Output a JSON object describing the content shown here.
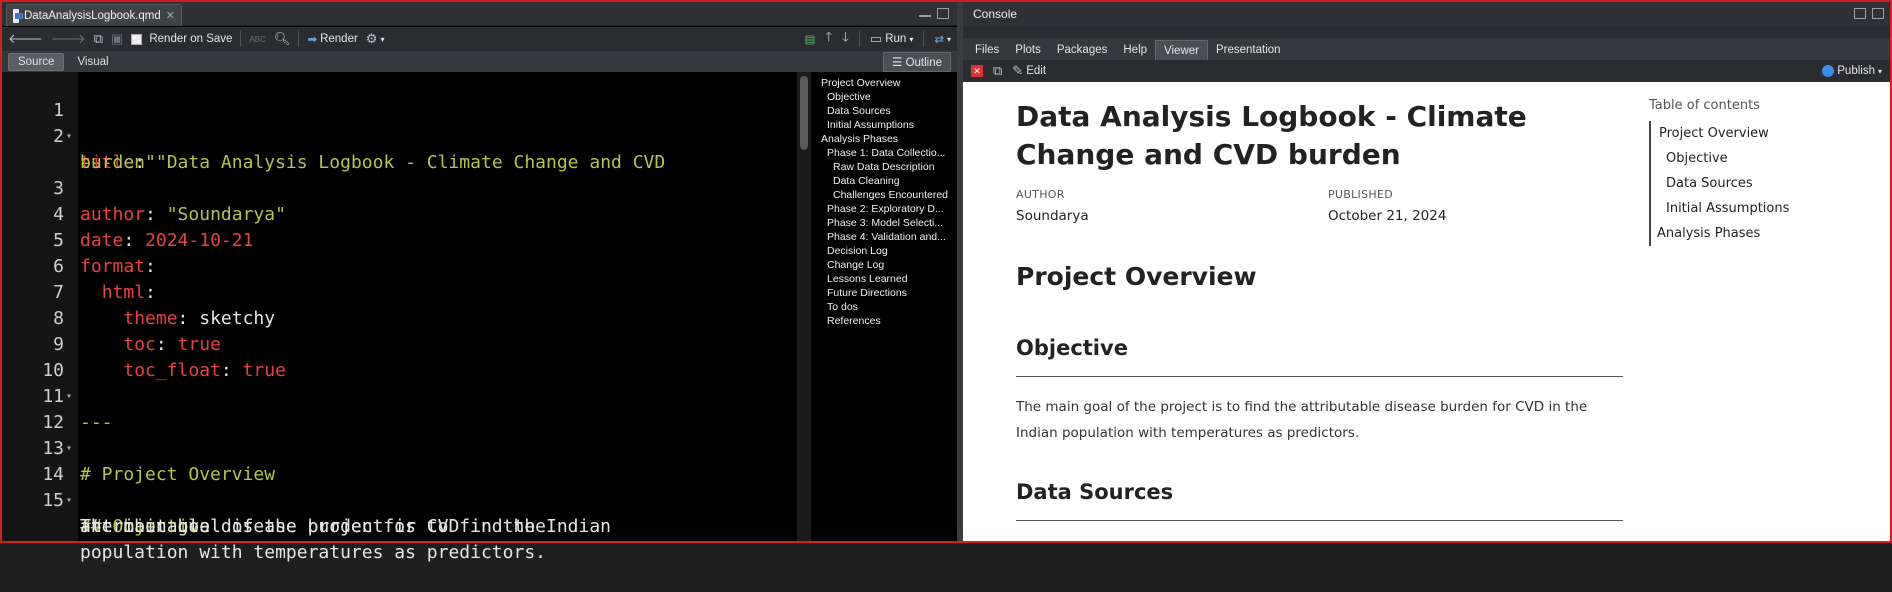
{
  "editor": {
    "tab_title": "DataAnalysisLogbook.qmd",
    "toolbar": {
      "render_on_save": "Render on Save",
      "render": "Render",
      "run": "Run",
      "abc": "ABC"
    },
    "source_label": "Source",
    "visual_label": "Visual",
    "outline_label": "Outline",
    "lines": [
      {
        "n": "1",
        "fold": true
      },
      {
        "n": "2"
      },
      {
        "n": "3"
      },
      {
        "n": "4"
      },
      {
        "n": "5"
      },
      {
        "n": "6"
      },
      {
        "n": "7"
      },
      {
        "n": "8"
      },
      {
        "n": "9"
      },
      {
        "n": "10",
        "fold": true
      },
      {
        "n": "11"
      },
      {
        "n": "12",
        "fold": true
      },
      {
        "n": "13"
      },
      {
        "n": "14",
        "fold": true
      },
      {
        "n": "15"
      }
    ],
    "code": {
      "l1": "---",
      "l2_key": "title",
      "l2_val_a": "\"Data Analysis Logbook - Climate Change and CVD",
      "l2_val_b": "burden\"",
      "l3_key": "author",
      "l3_val": "\"Soundarya\"",
      "l4_key": "date",
      "l4_val": "2024-10-21",
      "l5_key": "format",
      "l6_key": "html",
      "l7_key": "theme",
      "l7_val": "sketchy",
      "l8_key": "toc",
      "l8_val": "true",
      "l9_key": "toc_float",
      "l9_val": "true",
      "l10": "---",
      "l12": "# Project Overview",
      "l14": "## Objective",
      "l15_a": "The main goal of the project is to find the",
      "l15_b": "attributable disease burden for CVD in the Indian",
      "l15_c": "population with temperatures as predictors."
    },
    "outline": [
      {
        "label": "Project Overview",
        "level": 1
      },
      {
        "label": "Objective",
        "level": 2
      },
      {
        "label": "Data Sources",
        "level": 2
      },
      {
        "label": "Initial Assumptions",
        "level": 2
      },
      {
        "label": "Analysis Phases",
        "level": 1
      },
      {
        "label": "Phase 1: Data Collectio...",
        "level": 2
      },
      {
        "label": "Raw Data Description",
        "level": 3
      },
      {
        "label": "Data Cleaning",
        "level": 3
      },
      {
        "label": "Challenges Encountered",
        "level": 3
      },
      {
        "label": "Phase 2: Exploratory D...",
        "level": 2
      },
      {
        "label": "Phase 3: Model Selecti...",
        "level": 2
      },
      {
        "label": "Phase 4: Validation and...",
        "level": 2
      },
      {
        "label": "Decision Log",
        "level": 2
      },
      {
        "label": "Change Log",
        "level": 2
      },
      {
        "label": "Lessons Learned",
        "level": 2
      },
      {
        "label": "Future Directions",
        "level": 2
      },
      {
        "label": "To dos",
        "level": 2
      },
      {
        "label": "References",
        "level": 2
      }
    ]
  },
  "viewer": {
    "console_label": "Console",
    "tabs": [
      "Files",
      "Plots",
      "Packages",
      "Help",
      "Viewer",
      "Presentation"
    ],
    "active_tab": "Viewer",
    "edit_label": "Edit",
    "publish_label": "Publish",
    "doc": {
      "title": "Data Analysis Logbook - Climate Change and CVD burden",
      "author_label": "AUTHOR",
      "author": "Soundarya",
      "published_label": "PUBLISHED",
      "published": "October 21, 2024",
      "h1": "Project Overview",
      "h2_objective": "Objective",
      "paragraph": "The main goal of the project is to find the attributable disease burden for CVD in the Indian population with temperatures as predictors.",
      "h2_sources": "Data Sources"
    },
    "toc": {
      "title": "Table of contents",
      "items": [
        {
          "label": "Project Overview",
          "sub": false
        },
        {
          "label": "Objective",
          "sub": true
        },
        {
          "label": "Data Sources",
          "sub": true
        },
        {
          "label": "Initial Assumptions",
          "sub": true
        },
        {
          "label": "Analysis Phases",
          "sub": false,
          "out": true
        }
      ]
    }
  },
  "colors": {
    "frame": "#d61e1e",
    "keyword": "#e8423f",
    "string": "#b5c44a"
  }
}
